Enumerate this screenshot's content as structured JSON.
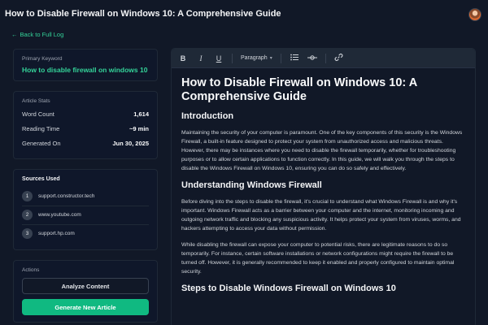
{
  "header": {
    "title": "How to Disable Firewall on Windows 10: A Comprehensive Guide",
    "back_label": "Back to Full Log"
  },
  "sidebar": {
    "keyword_label": "Primary Keyword",
    "keyword": "How to disable firewall on windows 10",
    "stats_label": "Article Stats",
    "stats": [
      {
        "label": "Word Count",
        "value": "1,614"
      },
      {
        "label": "Reading Time",
        "value": "~9 min"
      },
      {
        "label": "Generated On",
        "value": "Jun 30, 2025"
      }
    ],
    "sources_title": "Sources Used",
    "sources": [
      {
        "num": "1",
        "name": "support.constructor.tech"
      },
      {
        "num": "2",
        "name": "www.youtube.com"
      },
      {
        "num": "3",
        "name": "support.hp.com"
      }
    ],
    "actions_label": "Actions",
    "analyze_label": "Analyze Content",
    "generate_label": "Generate New Article"
  },
  "toolbar": {
    "bold": "B",
    "italic": "I",
    "underline": "U",
    "paragraph": "Paragraph"
  },
  "article": {
    "h1": "How to Disable Firewall on Windows 10: A Comprehensive Guide",
    "h2_intro": "Introduction",
    "p_intro": "Maintaining the security of your computer is paramount. One of the key components of this security is the Windows Firewall, a built-in feature designed to protect your system from unauthorized access and malicious threats. However, there may be instances where you need to disable the firewall temporarily, whether for troubleshooting purposes or to allow certain applications to function correctly. In this guide, we will walk you through the steps to disable the Windows Firewall on Windows 10, ensuring you can do so safely and effectively.",
    "h2_understanding": "Understanding Windows Firewall",
    "p_understanding_1": "Before diving into the steps to disable the firewall, it's crucial to understand what Windows Firewall is and why it's important. Windows Firewall acts as a barrier between your computer and the internet, monitoring incoming and outgoing network traffic and blocking any suspicious activity. It helps protect your system from viruses, worms, and hackers attempting to access your data without permission.",
    "p_understanding_2": "While disabling the firewall can expose your computer to potential risks, there are legitimate reasons to do so temporarily. For instance, certain software installations or network configurations might require the firewall to be turned off. However, it is generally recommended to keep it enabled and properly configured to maintain optimal security.",
    "h2_steps": "Steps to Disable Windows Firewall on Windows 10"
  },
  "colors": {
    "accent": "#10b981",
    "link": "#34d399",
    "background": "#111827"
  }
}
